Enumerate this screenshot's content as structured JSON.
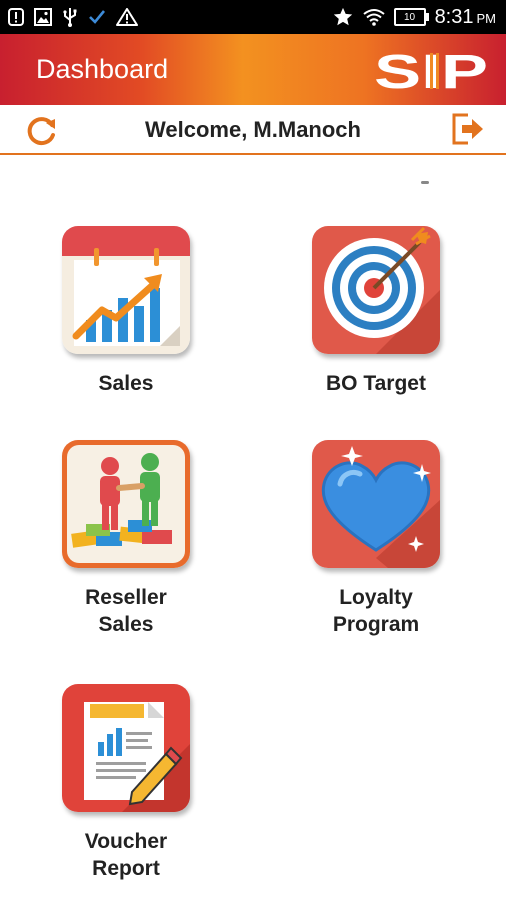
{
  "status_bar": {
    "time": "8:31",
    "ampm": "PM",
    "battery_level": "10",
    "icons_left": [
      "notification-icon",
      "image-icon",
      "usb-icon",
      "check-icon",
      "warning-icon"
    ],
    "icons_right": [
      "star-icon",
      "wifi-icon",
      "battery-icon"
    ]
  },
  "header": {
    "title": "Dashboard",
    "logo_text": "SIP"
  },
  "welcome": {
    "text": "Welcome, M.Manoch"
  },
  "menu": [
    {
      "label": "Sales",
      "icon": "sales-chart-icon"
    },
    {
      "label": "BO Target",
      "icon": "target-icon"
    },
    {
      "label": "Reseller\nSales",
      "icon": "reseller-sales-icon"
    },
    {
      "label": "Loyalty\nProgram",
      "icon": "heart-icon"
    },
    {
      "label": "Voucher\nReport",
      "icon": "report-icon"
    }
  ],
  "colors": {
    "accent": "#e2731e",
    "header_red": "#c8202f",
    "header_orange": "#f39120"
  }
}
